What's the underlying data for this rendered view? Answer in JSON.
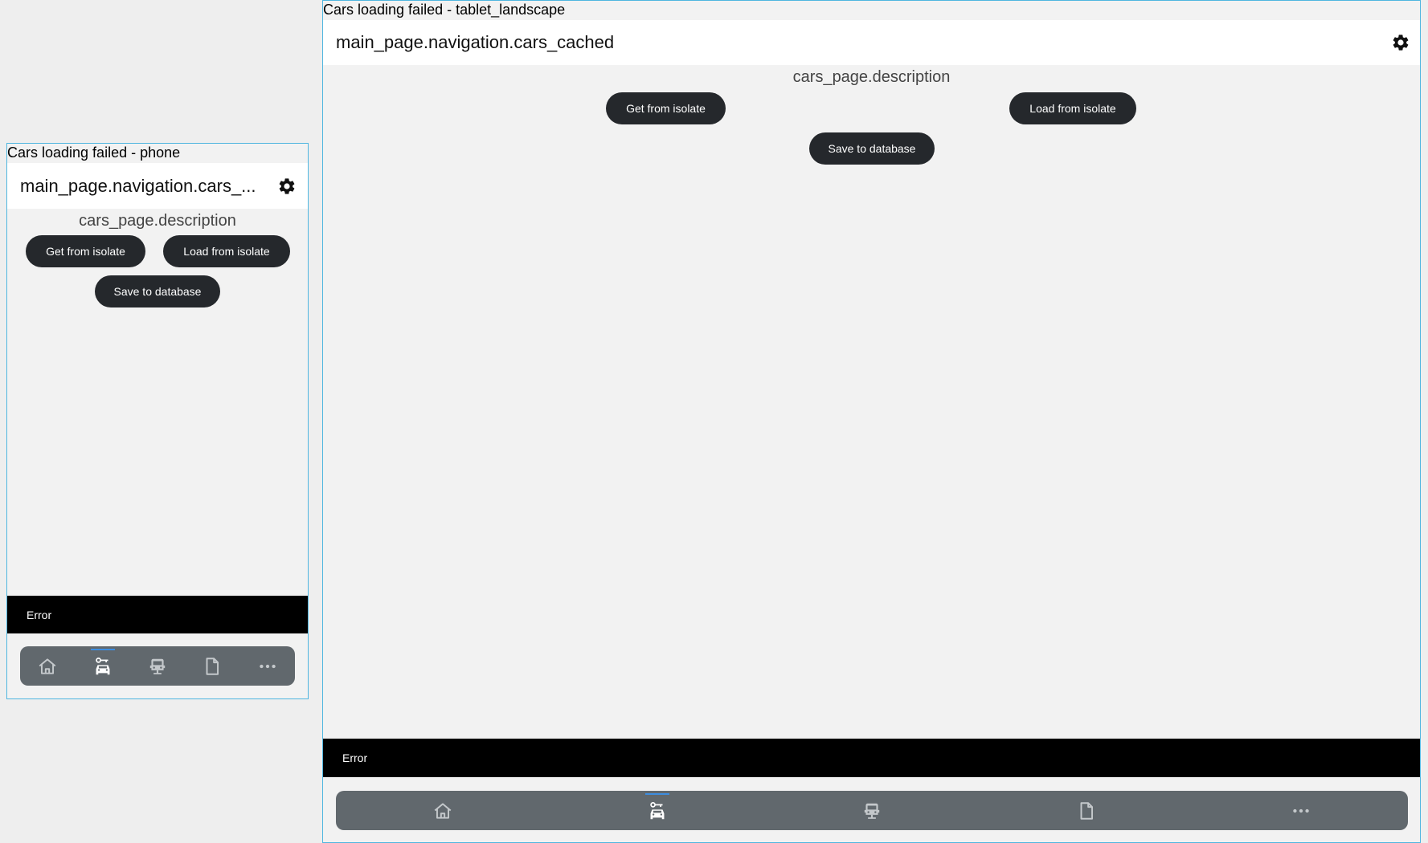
{
  "phone": {
    "frame_label": "Cars loading failed - phone",
    "appbar_title": "main_page.navigation.cars_...",
    "description": "cars_page.description",
    "get_button": "Get from isolate",
    "load_button": "Load from isolate",
    "save_button": "Save to database",
    "snackbar_text": "Error"
  },
  "tablet": {
    "frame_label": "Cars loading failed - tablet_landscape",
    "appbar_title": "main_page.navigation.cars_cached",
    "description": "cars_page.description",
    "get_button": "Get from isolate",
    "load_button": "Load from isolate",
    "save_button": "Save to database",
    "snackbar_text": "Error"
  },
  "nav": {
    "items": [
      {
        "icon": "home-icon",
        "active": false
      },
      {
        "icon": "car-key-icon",
        "active": true
      },
      {
        "icon": "car-seat-icon",
        "active": false
      },
      {
        "icon": "document-icon",
        "active": false
      },
      {
        "icon": "more-horizontal-icon",
        "active": false
      }
    ],
    "icon_color": "#c4c8cb",
    "active_color": "#ffffff",
    "indicator_color": "#3d8de0"
  },
  "colors": {
    "frame_border": "#4fb6e0",
    "button_bg": "#25282c",
    "navbar_bg": "#61686d",
    "snackbar_bg": "#000000",
    "appbar_bg": "#ffffff"
  }
}
